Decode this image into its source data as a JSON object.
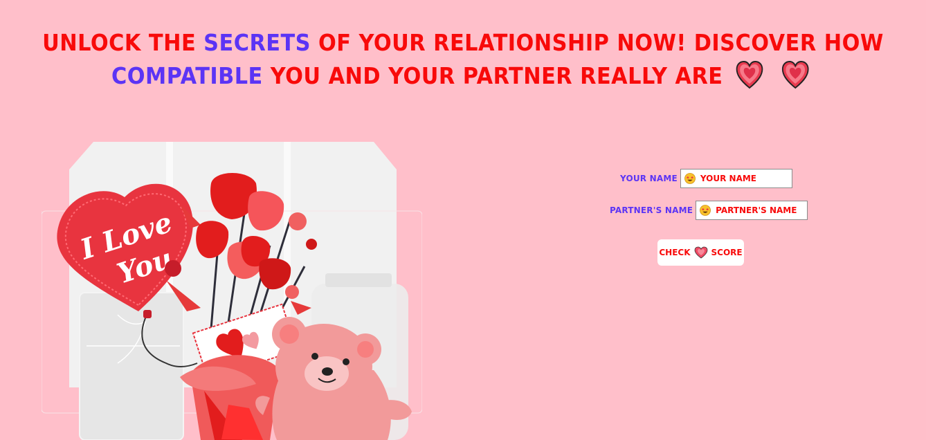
{
  "headline": {
    "part1": "UNLOCK THE ",
    "highlight1": "SECRETS",
    "part2": " OF YOUR RELATIONSHIP NOW! DISCOVER HOW ",
    "highlight2": "COMPATIBLE",
    "part3": " YOU AND YOUR PARTNER REALLY ARE",
    "emoji_icons": [
      "sparkling-heart-icon",
      "sparkling-heart-icon"
    ]
  },
  "illustration": {
    "icon": "valentine-bouquet-illustration",
    "balloon_text_line1": "I Love",
    "balloon_text_line2": "You"
  },
  "form": {
    "your_name_label": "YOUR NAME",
    "your_name_placeholder": "YOUR NAME",
    "your_name_value": "",
    "partner_name_label": "PARTNER'S NAME",
    "partner_name_placeholder": "PARTNER'S NAME",
    "partner_name_value": "",
    "input_icon": "star-struck-emoji-icon",
    "check_left": "CHECK",
    "check_right": "SCORE",
    "check_icon": "heart-icon"
  },
  "colors": {
    "background": "#ffbfca",
    "headline": "#f80a0a",
    "highlight": "#5b34f5"
  }
}
